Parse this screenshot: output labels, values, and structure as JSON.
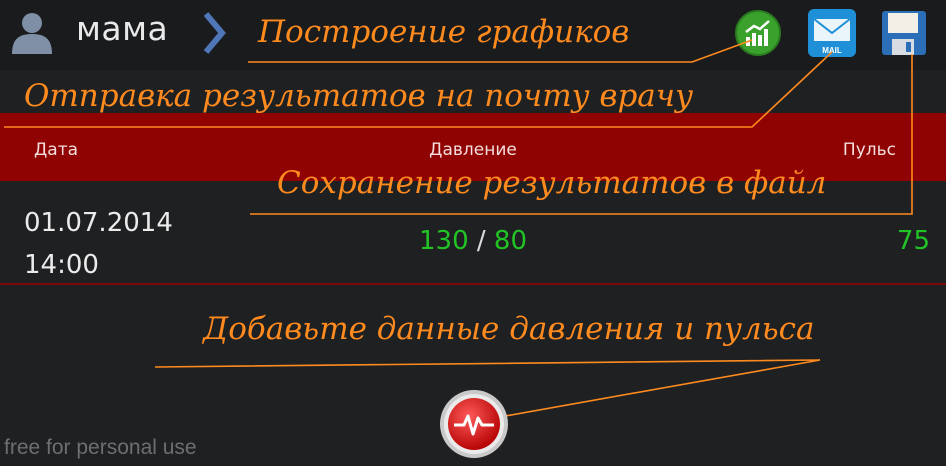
{
  "app": {
    "profile_name": "мама",
    "actions": {
      "charts_icon": "chart-icon",
      "mail_icon": "mail-icon",
      "mail_badge": "MAIL",
      "save_icon": "floppy-disk-icon"
    }
  },
  "table": {
    "headers": {
      "date": "Дата",
      "pressure": "Давление",
      "pulse": "Пульс"
    },
    "rows": [
      {
        "date": "01.07.2014",
        "time": "14:00",
        "systolic": "130",
        "separator": "/",
        "diastolic": "80",
        "pulse": "75"
      }
    ]
  },
  "annotations": {
    "charts": "Построение графиков",
    "mail": "Отправка результатов на почту врачу",
    "save": "Сохранение результатов в файл",
    "add": "Добавьте данные давления и пульса"
  },
  "add_button_icon": "heartbeat-icon",
  "watermark": "free for personal use",
  "colors": {
    "header_red": "#8f0303",
    "value_green": "#22c425",
    "annotation_orange": "#ff8a1e"
  }
}
